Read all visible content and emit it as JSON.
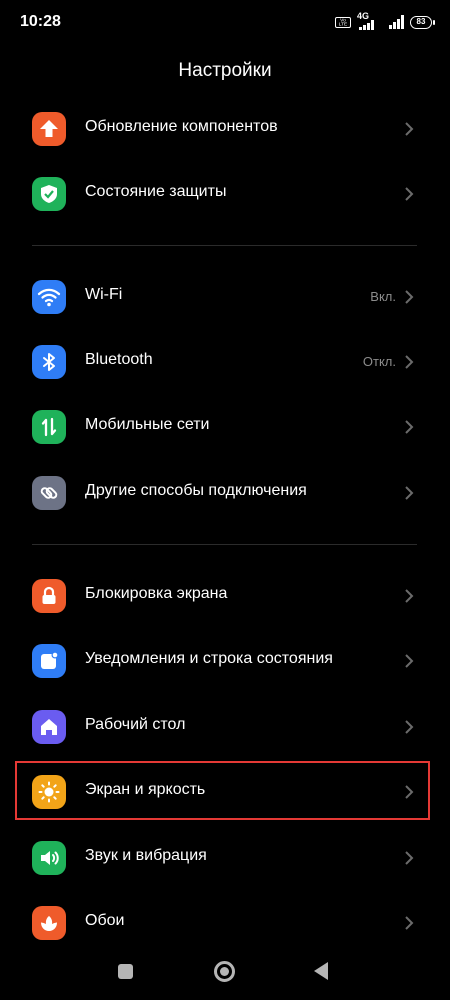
{
  "status_bar": {
    "time": "10:28",
    "volte": "Vo LTE",
    "network": "4G",
    "battery": "83"
  },
  "page_title": "Настройки",
  "sections": [
    {
      "items": [
        {
          "label": "Обновление компонентов",
          "icon": "arrow-up-icon",
          "color": "#ef5b2b"
        },
        {
          "label": "Состояние защиты",
          "icon": "shield-check-icon",
          "color": "#1fb25a"
        }
      ]
    },
    {
      "items": [
        {
          "label": "Wi-Fi",
          "value": "Вкл.",
          "icon": "wifi-icon",
          "color": "#2f7df6"
        },
        {
          "label": "Bluetooth",
          "value": "Откл.",
          "icon": "bluetooth-icon",
          "color": "#2f7df6"
        },
        {
          "label": "Мобильные сети",
          "icon": "mobile-data-icon",
          "color": "#1fb25a"
        },
        {
          "label": "Другие способы подключения",
          "icon": "link-icon",
          "color": "#6d7386"
        }
      ]
    },
    {
      "items": [
        {
          "label": "Блокировка экрана",
          "icon": "lock-icon",
          "color": "#ef5b2b"
        },
        {
          "label": "Уведомления и строка состояния",
          "icon": "notification-icon",
          "color": "#2f7df6"
        },
        {
          "label": "Рабочий стол",
          "icon": "home-icon",
          "color": "#6a5cf0"
        },
        {
          "label": "Экран и яркость",
          "icon": "sun-icon",
          "color": "#f2a418"
        },
        {
          "label": "Звук и вибрация",
          "icon": "speaker-icon",
          "color": "#1fb25a"
        },
        {
          "label": "Обои",
          "icon": "flower-icon",
          "color": "#ef5b2b"
        }
      ]
    }
  ],
  "highlight_color": "#e53935",
  "nav_bar": {
    "icons": [
      "recents-square-icon",
      "home-circle-icon",
      "back-triangle-icon"
    ]
  }
}
